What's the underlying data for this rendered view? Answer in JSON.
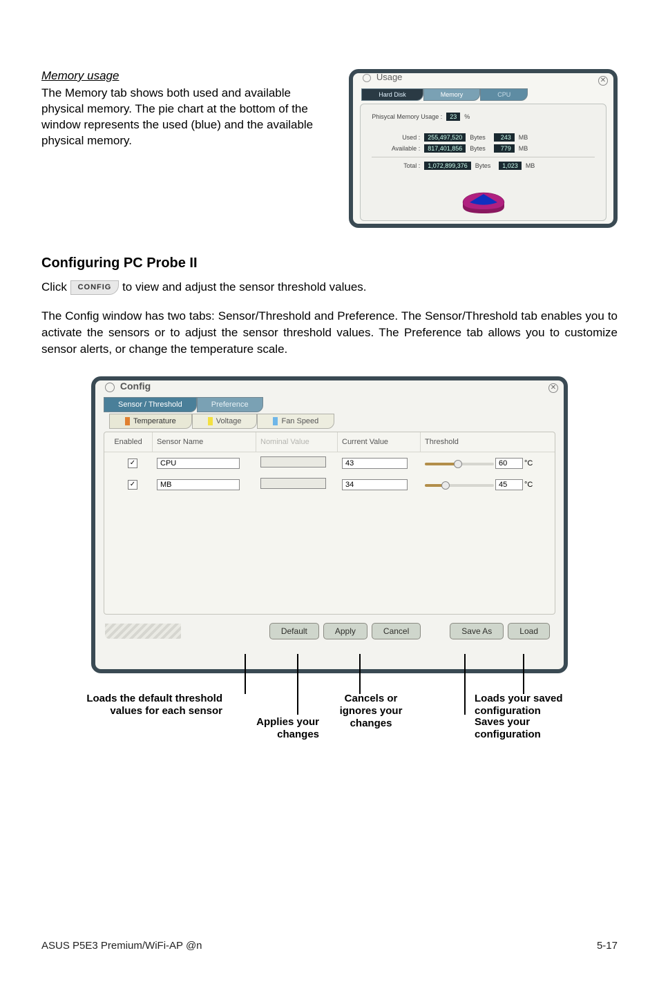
{
  "memory_section": {
    "heading": "Memory usage",
    "body": "The Memory tab shows both used and available physical memory. The pie chart at the bottom of the window represents the used (blue) and the available physical memory."
  },
  "usage_window": {
    "title": "Usage",
    "tabs": {
      "hd": "Hard Disk",
      "mem": "Memory",
      "cpu": "CPU"
    },
    "pct_label": "Phisycal Memory Usage :",
    "pct_value": "23",
    "pct_unit": "%",
    "rows": [
      {
        "label": "Used :",
        "bytes": "255,497,520",
        "bytes_unit": "Bytes",
        "mb": "243",
        "mb_unit": "MB"
      },
      {
        "label": "Available :",
        "bytes": "817,401,856",
        "bytes_unit": "Bytes",
        "mb": "779",
        "mb_unit": "MB"
      }
    ],
    "total": {
      "label": "Total :",
      "bytes": "1,072,899,376",
      "bytes_unit": "Bytes",
      "mb": "1,023",
      "mb_unit": "MB"
    }
  },
  "config_heading": "Configuring PC Probe II",
  "click_line_prefix": "Click ",
  "click_button": "CONFIG",
  "click_line_suffix": " to view and adjust the sensor threshold values.",
  "config_para": "The Config window has two tabs: Sensor/Threshold and Preference. The Sensor/Threshold tab enables you to activate the sensors or to adjust the sensor threshold values. The Preference tab allows you to customize sensor alerts, or change the temperature scale.",
  "config_window": {
    "title": "Config",
    "tabs1": {
      "sensor": "Sensor / Threshold",
      "pref": "Preference"
    },
    "tabs2": {
      "temp": "Temperature",
      "volt": "Voltage",
      "fan": "Fan Speed"
    },
    "columns": {
      "enabled": "Enabled",
      "sensor_name": "Sensor Name",
      "nominal": "Nominal Value",
      "current": "Current Value",
      "threshold": "Threshold"
    },
    "rows": [
      {
        "name": "CPU",
        "current": "43",
        "threshold": "60",
        "unit": "°C",
        "slider_pct": "48%"
      },
      {
        "name": "MB",
        "current": "34",
        "threshold": "45",
        "unit": "°C",
        "slider_pct": "30%"
      }
    ],
    "buttons": {
      "default": "Default",
      "apply": "Apply",
      "cancel": "Cancel",
      "saveas": "Save As",
      "load": "Load"
    }
  },
  "callouts": {
    "default": "Loads the default threshold values for each sensor",
    "apply": "Applies your changes",
    "cancel": "Cancels or ignores your changes",
    "load": "Loads your saved configuration",
    "saveas": "Saves your configuration"
  },
  "footer": {
    "left": "ASUS P5E3 Premium/WiFi-AP @n",
    "right": "5-17"
  }
}
